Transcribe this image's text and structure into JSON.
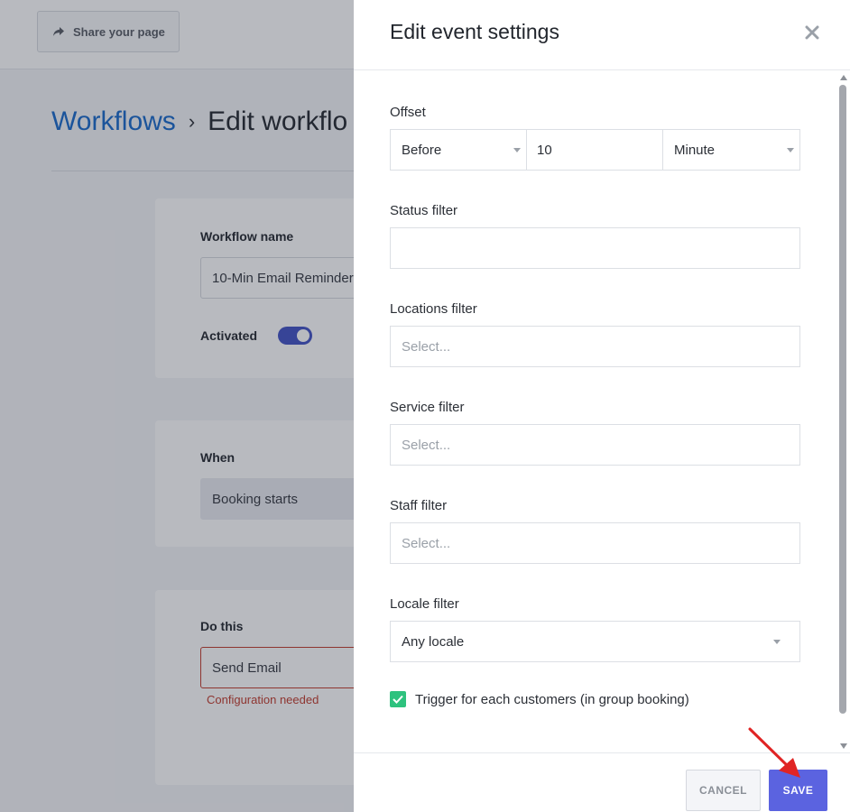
{
  "background_page": {
    "share_button_label": "Share your page",
    "breadcrumb": {
      "parent": "Workflows",
      "separator": "›",
      "current": "Edit workflo"
    },
    "workflow_card": {
      "name_label": "Workflow name",
      "name_value": "10-Min Email Reminder",
      "activated_label": "Activated",
      "activated": true
    },
    "when_card": {
      "label": "When",
      "value": "Booking starts"
    },
    "do_card": {
      "label": "Do this",
      "value": "Send Email",
      "error": "Configuration needed"
    }
  },
  "modal": {
    "title": "Edit event settings",
    "offset": {
      "label": "Offset",
      "direction": "Before",
      "amount": "10",
      "unit": "Minute"
    },
    "status_filter": {
      "label": "Status filter",
      "value": ""
    },
    "locations_filter": {
      "label": "Locations filter",
      "placeholder": "Select..."
    },
    "service_filter": {
      "label": "Service filter",
      "placeholder": "Select..."
    },
    "staff_filter": {
      "label": "Staff filter",
      "placeholder": "Select..."
    },
    "locale_filter": {
      "label": "Locale filter",
      "value": "Any locale"
    },
    "trigger_checkbox": {
      "label": "Trigger for each customers (in group booking)",
      "checked": true
    },
    "cancel_label": "CANCEL",
    "save_label": "SAVE"
  },
  "colors": {
    "link_blue": "#1668c9",
    "primary_button": "#5b63e0",
    "checkbox_green": "#2ec27e",
    "error_red": "#c0392b",
    "annotation_arrow": "#e02424"
  }
}
